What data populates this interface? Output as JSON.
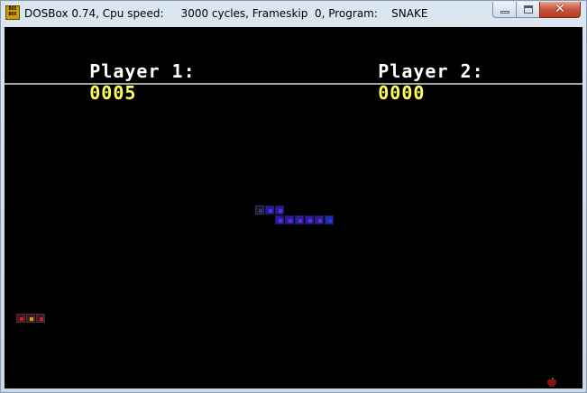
{
  "window": {
    "title": "DOSBox 0.74, Cpu speed:     3000 cycles, Frameskip  0, Program:    SNAKE",
    "icon_text_top": "DOS",
    "icon_text_bottom": "BOX",
    "close_glyph": "✕"
  },
  "game": {
    "player1_label": "Player 1:",
    "player1_score": "0005",
    "player2_label": "Player 2:",
    "player2_score": "0000"
  },
  "colors": {
    "background": "#000000",
    "label": "#ffffff",
    "score": "#ffff55",
    "snake_blue": "#2a1ca0",
    "snake_red": "#c0202a",
    "apple": "#8b1010"
  }
}
